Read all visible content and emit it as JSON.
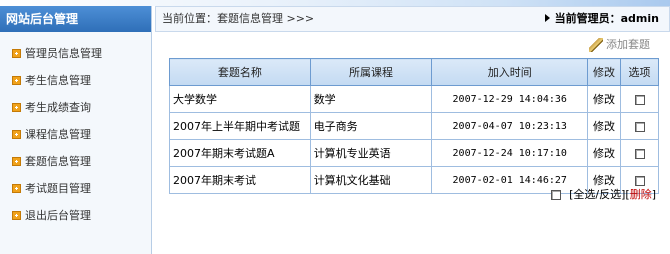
{
  "sidebar": {
    "title": "网站后台管理",
    "items": [
      {
        "label": "管理员信息管理"
      },
      {
        "label": "考生信息管理"
      },
      {
        "label": "考生成绩查询"
      },
      {
        "label": "课程信息管理"
      },
      {
        "label": "套题信息管理"
      },
      {
        "label": "考试题目管理"
      },
      {
        "label": "退出后台管理"
      }
    ]
  },
  "header": {
    "breadcrumb": "当前位置：套题信息管理 >>>",
    "current_admin": "当前管理员：admin"
  },
  "toolbar": {
    "add_label": "添加套题"
  },
  "table": {
    "columns": [
      "套题名称",
      "所属课程",
      "加入时间",
      "修改",
      "选项"
    ],
    "rows": [
      {
        "name": "大学数学",
        "course": "数学",
        "time": "2007-12-29 14:04:36",
        "edit": "修改"
      },
      {
        "name": "2007年上半年期中考试题",
        "course": "电子商务",
        "time": "2007-04-07 10:23:13",
        "edit": "修改"
      },
      {
        "name": "2007年期末考试题A",
        "course": "计算机专业英语",
        "time": "2007-12-24 10:17:10",
        "edit": "修改"
      },
      {
        "name": "2007年期末考试",
        "course": "计算机文化基础",
        "time": "2007-02-01 14:46:27",
        "edit": "修改"
      }
    ]
  },
  "footer": {
    "select_all": "[全选/反选]",
    "delete_open": "[",
    "delete_label": "删除",
    "delete_close": "]"
  },
  "colors": {
    "accent": "#2f6fb8",
    "table_border": "#6d9bd0",
    "delete": "#c00000",
    "bullet": "#f0a21b"
  },
  "icons": {
    "sidebar_bullet": "plus-square-icon",
    "add": "pencil-icon",
    "breadcrumb_right": "triangle-right-icon"
  }
}
